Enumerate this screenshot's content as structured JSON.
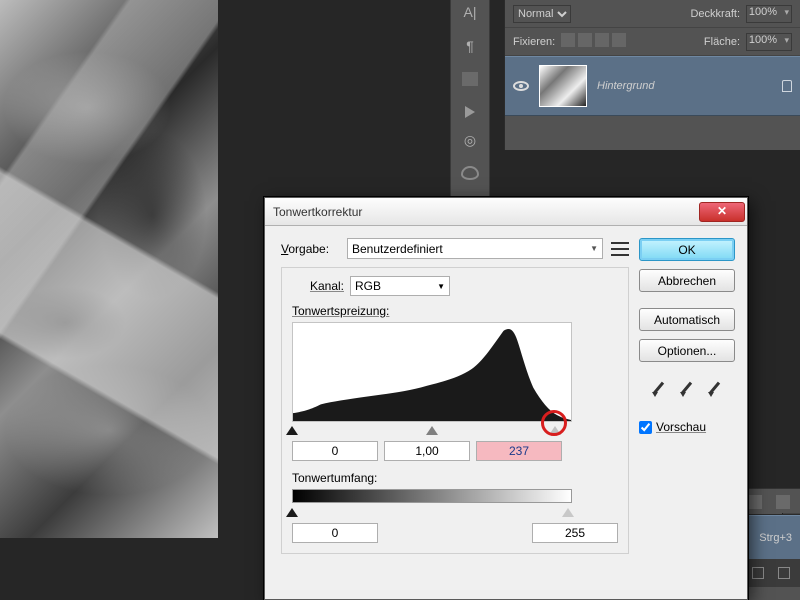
{
  "canvas": {
    "dummy": "ice-shards-bw"
  },
  "toolstrip": {
    "icons": [
      "A|",
      "¶",
      "⠿",
      "▶",
      "◌",
      "🎨"
    ]
  },
  "layers": {
    "blend_mode": "Normal",
    "opacity_label": "Deckkraft:",
    "opacity_value": "100%",
    "lock_label": "Fixieren:",
    "fill_label": "Fläche:",
    "fill_value": "100%",
    "layer_name": "Hintergrund"
  },
  "channels": {
    "visible_name": "",
    "shortcut": "Strg+3"
  },
  "dialog": {
    "title": "Tonwertkorrektur",
    "preset_label": "Vorgabe:",
    "preset_value": "Benutzerdefiniert",
    "channel_label": "Kanal:",
    "channel_value": "RGB",
    "histogram_label": "Tonwertspreizung:",
    "shadows": "0",
    "midtones": "1,00",
    "highlights": "237",
    "output_label": "Tonwertumfang:",
    "out_low": "0",
    "out_high": "255",
    "ok": "OK",
    "cancel": "Abbrechen",
    "auto": "Automatisch",
    "options": "Optionen...",
    "preview": "Vorschau"
  }
}
